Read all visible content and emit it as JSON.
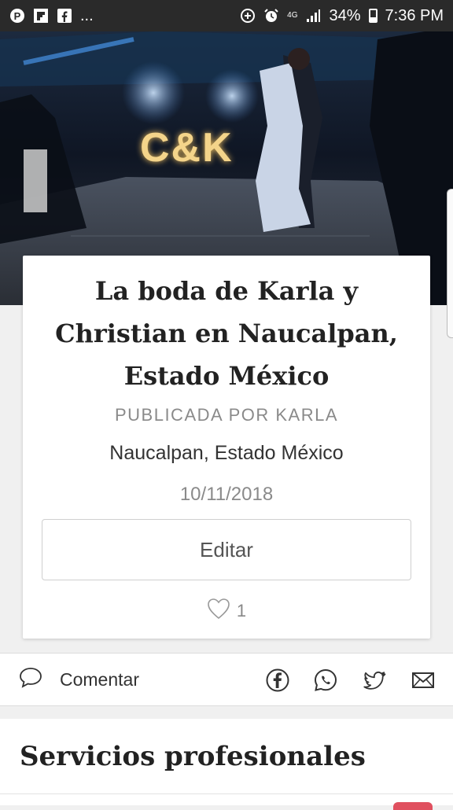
{
  "status_bar": {
    "more_indicator": "...",
    "network": "4G",
    "battery_text": "34%",
    "battery_level": 0.34,
    "time": "7:36 PM"
  },
  "hero": {
    "sign_text": "C&K"
  },
  "post": {
    "title": "La boda de Karla y Christian en Naucalpan, Estado México",
    "published_by": "PUBLICADA POR KARLA",
    "location": "Naucalpan, Estado México",
    "date": "10/11/2018",
    "edit_label": "Editar",
    "likes_count": "1"
  },
  "actions": {
    "comment_label": "Comentar",
    "share_icons": [
      "facebook-icon",
      "whatsapp-icon",
      "twitter-icon",
      "email-icon"
    ]
  },
  "section": {
    "title": "Servicios profesionales"
  },
  "colors": {
    "status_bar_bg": "#2a2a2a",
    "title_text": "#222222",
    "muted_text": "#8a8a8a",
    "badge": "#e0505f"
  }
}
